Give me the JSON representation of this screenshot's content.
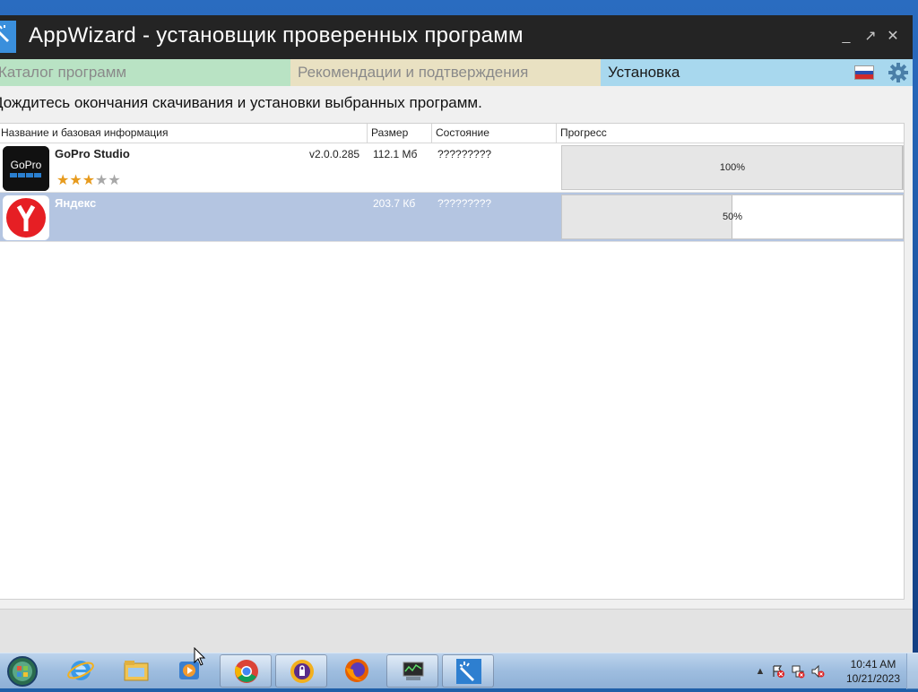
{
  "window": {
    "title": "AppWizard - установщик проверенных программ",
    "controls": {
      "minimize": "_",
      "maximize": "↗",
      "close": "✕"
    }
  },
  "tabs": [
    {
      "label": "Каталог программ"
    },
    {
      "label": "Рекомендации и подтверждения"
    },
    {
      "label": "Установка",
      "active": true
    }
  ],
  "instruction": "Дождитесь окончания скачивания и установки выбранных программ.",
  "table": {
    "columns": [
      "Название и базовая информация",
      "Размер",
      "Состояние",
      "Прогресс"
    ],
    "rows": [
      {
        "name": "GoPro Studio",
        "version": "v2.0.0.285",
        "size": "112.1 Мб",
        "status": "?????????",
        "progress_label": "100%",
        "progress": 1.0,
        "rating": 3,
        "rating_max": 5,
        "icon": "gopro-icon",
        "icon_text": "GoPro",
        "selected": false
      },
      {
        "name": "Яндекс",
        "version": "",
        "size": "203.7 Кб",
        "status": "?????????",
        "progress_label": "50%",
        "progress": 0.5,
        "icon": "yandex-icon",
        "selected": true
      }
    ]
  },
  "taskbar": {
    "pinned": [
      "ie-icon",
      "explorer-icon",
      "media-player-icon",
      "chrome-icon",
      "security-app-icon",
      "firefox-icon",
      "system-monitor-icon",
      "appwizard-icon"
    ],
    "clock_time": "10:41 AM",
    "clock_date": "10/21/2023"
  },
  "colors": {
    "titlebar": "#242424",
    "tab_catalog": "#b9e3c4",
    "tab_recs": "#e9e1c2",
    "tab_install": "#a8d8ee",
    "selected_row": "#b4c5e1",
    "star": "#e79b1e"
  }
}
